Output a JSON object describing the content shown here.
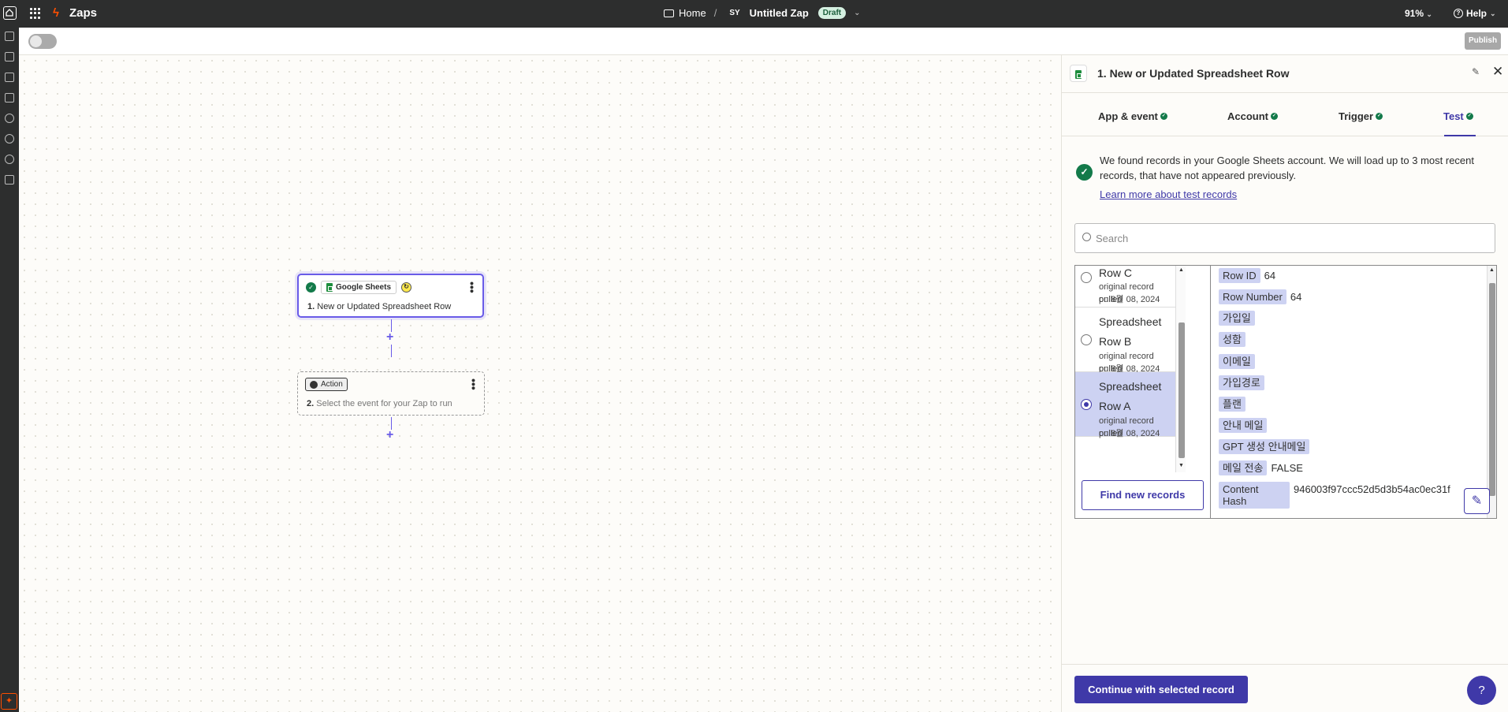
{
  "topbar": {
    "app_name": "Zaps",
    "breadcrumb_home": "Home",
    "breadcrumb_sep": "/",
    "avatar_initials": "SY",
    "zap_name": "Untitled Zap",
    "status_badge": "Draft",
    "zoom": "91%",
    "help": "Help"
  },
  "toolbar": {
    "publish": "Publish"
  },
  "canvas": {
    "trigger": {
      "app": "Google Sheets",
      "number": "1.",
      "title": "New or Updated Spreadsheet Row"
    },
    "action": {
      "badge": "Action",
      "number": "2.",
      "title": "Select the event for your Zap to run"
    },
    "add_symbol": "+"
  },
  "panel": {
    "title": "1. New or Updated Spreadsheet Row",
    "tabs": [
      {
        "label": "App & event",
        "done": true
      },
      {
        "label": "Account",
        "done": true
      },
      {
        "label": "Trigger",
        "done": true
      },
      {
        "label": "Test",
        "done": true,
        "active": true
      }
    ],
    "found_message": "We found records in your Google Sheets account. We will load up to 3 most recent records, that have not appeared previously.",
    "learn_more": "Learn more about test records",
    "search_placeholder": "Search",
    "records": [
      {
        "name_line1": "Row C",
        "name_line2": "",
        "sub1": "original record pulled",
        "sub2": "on 8월 08, 2024",
        "selected": false
      },
      {
        "name_line1": "Spreadsheet",
        "name_line2": "Row B",
        "sub1": "original record pulled",
        "sub2": "on 8월 08, 2024",
        "selected": false
      },
      {
        "name_line1": "Spreadsheet",
        "name_line2": "Row A",
        "sub1": "original record pulled",
        "sub2": "on 8월 08, 2024",
        "selected": true
      }
    ],
    "find_new_records": "Find new records",
    "fields": [
      {
        "key": "Row ID",
        "value": "64"
      },
      {
        "key": "Row Number",
        "value": "64"
      },
      {
        "key": "가입일",
        "value": ""
      },
      {
        "key": "성함",
        "value": ""
      },
      {
        "key": "이메일",
        "value": ""
      },
      {
        "key": "가입경로",
        "value": ""
      },
      {
        "key": "플랜",
        "value": ""
      },
      {
        "key": "안내 메일",
        "value": ""
      },
      {
        "key": "GPT 생성 안내메일",
        "value": ""
      },
      {
        "key": "메일 전송",
        "value": "FALSE"
      },
      {
        "key_line1": "Content",
        "key_line2": "Hash",
        "value": "946003f97ccc52d5d3b54ac0ec31f"
      }
    ],
    "continue": "Continue with selected record"
  },
  "colors": {
    "accent": "#3f39a8",
    "success": "#137a4a",
    "brand": "#ff4f00",
    "topbar": "#2d2e2e"
  }
}
